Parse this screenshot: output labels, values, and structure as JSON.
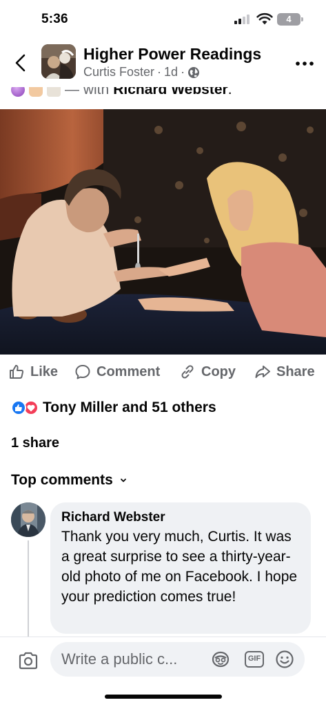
{
  "status_bar": {
    "time": "5:36",
    "battery": "4"
  },
  "header": {
    "page_name": "Higher Power Readings",
    "author": "Curtis Foster",
    "separator": "·",
    "age": "1d",
    "audience_icon": "globe-icon",
    "more_icon": "more-horizontal-icon",
    "back_icon": "chevron-left-icon"
  },
  "caption": {
    "with_text": "— with",
    "tagged": "Richard Webster",
    "end": "."
  },
  "photo": {
    "description_icon": "post-photo"
  },
  "actions": [
    {
      "label": "Like",
      "icon": "thumbs-up-icon"
    },
    {
      "label": "Comment",
      "icon": "comment-icon"
    },
    {
      "label": "Copy",
      "icon": "link-icon"
    },
    {
      "label": "Share",
      "icon": "share-arrow-icon"
    }
  ],
  "reactions": {
    "summary": "Tony Miller and 51 others",
    "colors": {
      "like": "#1877f2",
      "love": "#f33e58"
    }
  },
  "shares": "1 share",
  "comments": {
    "sort_label": "Top comments",
    "items": [
      {
        "author": "Richard Webster",
        "text": "Thank you very much, Curtis. It was a great surprise to see a thirty-year-old photo of me on Facebook. I hope your prediction comes true!"
      }
    ]
  },
  "composer": {
    "placeholder": "Write a public c...",
    "gif_label": "GIF"
  },
  "colors": {
    "secondary_text": "#65676b",
    "bubble": "#eff1f4",
    "accent": "#1877f2"
  }
}
